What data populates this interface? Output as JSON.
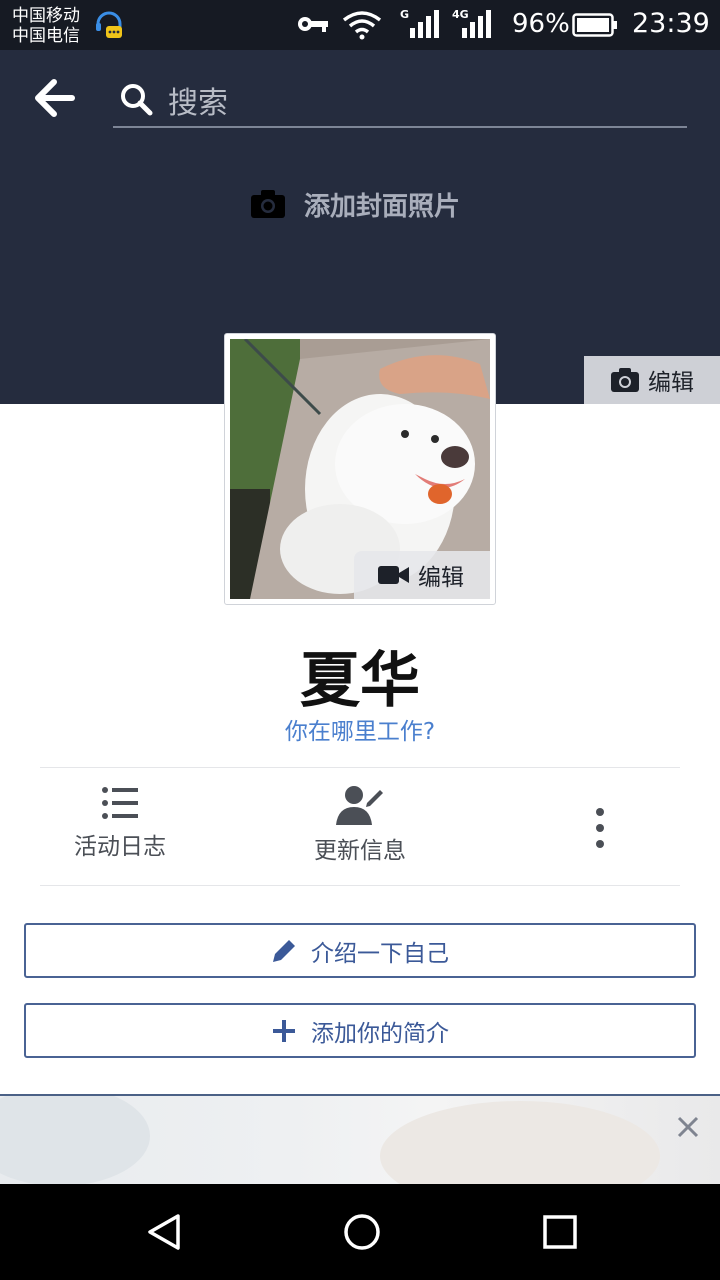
{
  "status_bar": {
    "carrier_1": "中国移动",
    "carrier_2": "中国电信",
    "signal_1_tag": "G",
    "signal_2_tag": "4G",
    "battery": "96%",
    "time": "23:39"
  },
  "header": {
    "search_placeholder": "搜索"
  },
  "cover": {
    "add_cover_label": "添加封面照片",
    "edit_label": "编辑"
  },
  "profile": {
    "photo_edit_label": "编辑",
    "name": "夏华",
    "workplace_prompt": "你在哪里工作?"
  },
  "actions": [
    {
      "label": "活动日志",
      "icon": "list-icon"
    },
    {
      "label": "更新信息",
      "icon": "person-edit-icon"
    },
    {
      "label": "",
      "icon": "more-vertical-icon"
    }
  ],
  "buttons": {
    "intro": "介绍一下自己",
    "add_bio": "添加你的简介"
  },
  "colors": {
    "cover_bg": "#252c3e",
    "link_blue": "#4a7fce",
    "brand_blue": "#3b5998"
  }
}
